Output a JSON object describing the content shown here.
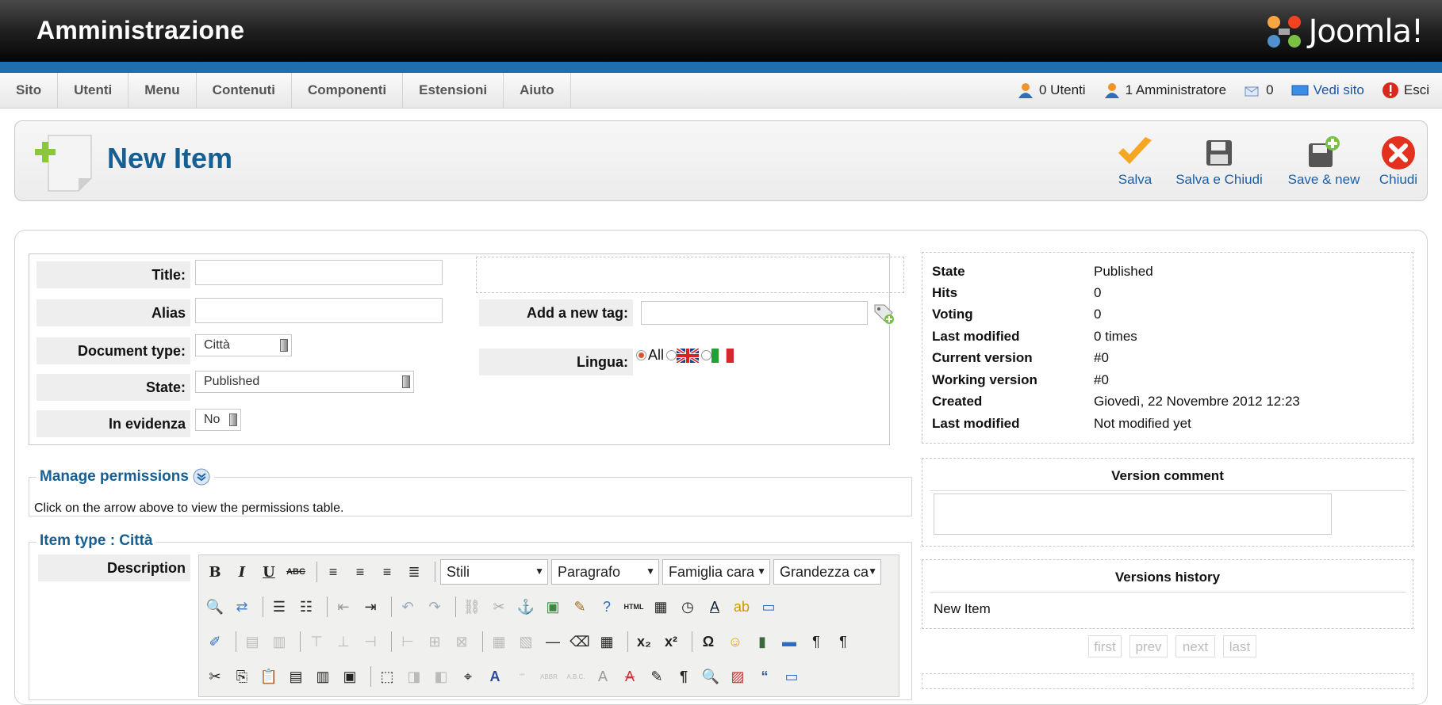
{
  "header": {
    "title": "Amministrazione",
    "logo_text": "Joomla!"
  },
  "menu": {
    "items": [
      "Sito",
      "Utenti",
      "Menu",
      "Contenuti",
      "Componenti",
      "Estensioni",
      "Aiuto"
    ]
  },
  "status": {
    "users": "0 Utenti",
    "admins": "1 Amministratore",
    "messages": "0",
    "view_site": "Vedi sito",
    "logout": "Esci"
  },
  "toolbar": {
    "page_title": "New Item",
    "save": "Salva",
    "save_close": "Salva e Chiudi",
    "save_new": "Save & new",
    "close": "Chiudi"
  },
  "form": {
    "title_label": "Title:",
    "alias_label": "Alias",
    "doctype_label": "Document type:",
    "doctype_value": "Città",
    "state_label": "State:",
    "state_value": "Published",
    "featured_label": "In evidenza",
    "featured_value": "No",
    "tag_label": "Add a new tag:",
    "lang_label": "Lingua:",
    "lang_all": "All"
  },
  "info": [
    {
      "k": "State",
      "v": "Published"
    },
    {
      "k": "Hits",
      "v": "0"
    },
    {
      "k": "Voting",
      "v": "0"
    },
    {
      "k": "Last modified",
      "v": "0 times"
    },
    {
      "k": "Current version",
      "v": "#0"
    },
    {
      "k": "Working version",
      "v": "#0"
    },
    {
      "k": "Created",
      "v": "Giovedì, 22 Novembre 2012 12:23"
    },
    {
      "k": "Last modified",
      "v": "Not modified yet"
    }
  ],
  "version_comment": {
    "title": "Version comment"
  },
  "versions_history": {
    "title": "Versions history",
    "item": "New Item",
    "pager": [
      "first",
      "prev",
      "next",
      "last"
    ]
  },
  "permissions": {
    "legend": "Manage permissions",
    "text": "Click on the arrow above to view the permissions table."
  },
  "item_type": {
    "legend": "Item type : Città",
    "description_label": "Description"
  },
  "editor": {
    "styles": "Stili",
    "format": "Paragrafo",
    "font_family": "Famiglia cara",
    "font_size": "Grandezza ca"
  },
  "colors": {
    "brand_blue": "#1f6fae",
    "title_blue": "#165f93",
    "link_blue": "#1a56a8"
  }
}
